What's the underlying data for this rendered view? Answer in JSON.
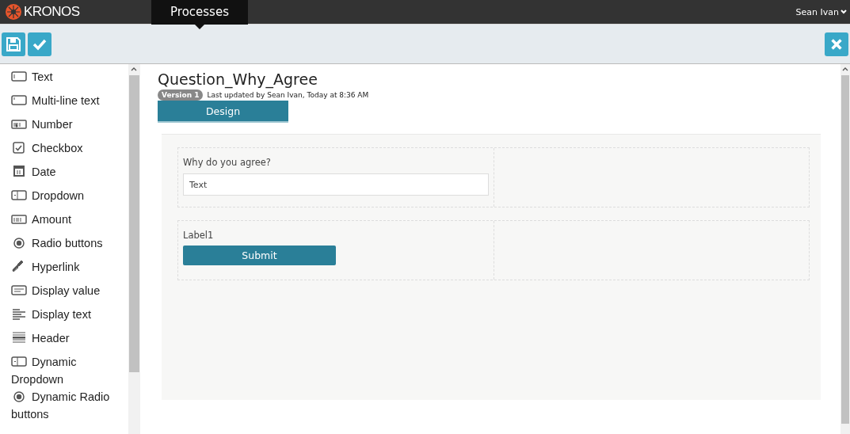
{
  "header": {
    "logo": "KRONOS",
    "nav": [
      {
        "label": "Processes",
        "selected": true
      }
    ],
    "user": "Sean Ivan"
  },
  "toolbar": {
    "buttons": [
      {
        "kind": "save"
      },
      {
        "kind": "check"
      }
    ],
    "close": true
  },
  "palette": [
    {
      "kind": "text",
      "label": "Text"
    },
    {
      "kind": "multiline",
      "label": "Multi-line text"
    },
    {
      "kind": "number",
      "label": "Number"
    },
    {
      "kind": "checkbox",
      "label": "Checkbox"
    },
    {
      "kind": "date",
      "label": "Date"
    },
    {
      "kind": "dropdown",
      "label": "Dropdown"
    },
    {
      "kind": "amount",
      "label": "Amount"
    },
    {
      "kind": "radio",
      "label": "Radio buttons"
    },
    {
      "kind": "link",
      "label": "Hyperlink"
    },
    {
      "kind": "display-value",
      "label": "Display value"
    },
    {
      "kind": "display-text",
      "label": "Display text"
    },
    {
      "kind": "header",
      "label": "Header"
    },
    {
      "kind": "dropdown",
      "label": "Dynamic Dropdown"
    },
    {
      "kind": "radio",
      "label": "Dynamic Radio buttons"
    }
  ],
  "form": {
    "title": "Question_Why_Agree",
    "version": "Version 1",
    "updated": "Last updated by Sean Ivan, Today at 8:36 AM",
    "tabs": [
      {
        "label": "Design",
        "selected": true
      }
    ],
    "rows": [
      {
        "kind": "input",
        "label": "Why do you agree?",
        "placeholder": "Text"
      },
      {
        "kind": "button",
        "label": "Label1",
        "button": "Submit"
      }
    ]
  }
}
